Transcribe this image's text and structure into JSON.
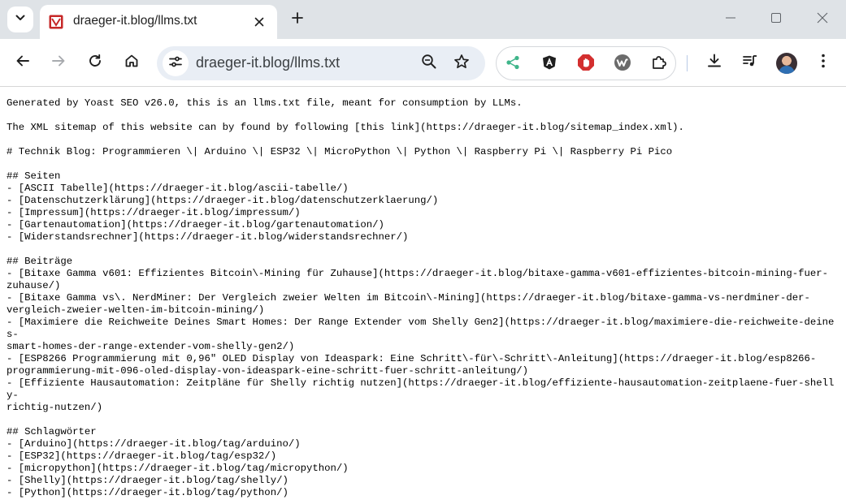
{
  "tab": {
    "title": "draeger-it.blog/llms.txt"
  },
  "toolbar": {
    "url": "draeger-it.blog/llms.txt"
  },
  "extensions": [
    "share-icon",
    "angular-icon",
    "adblock-icon",
    "wappalyzer-icon",
    "puzzle-icon"
  ],
  "document": {
    "lines": [
      "Generated by Yoast SEO v26.0, this is an llms.txt file, meant for consumption by LLMs.",
      "",
      "The XML sitemap of this website can by found by following [this link](https://draeger-it.blog/sitemap_index.xml).",
      "",
      "# Technik Blog: Programmieren \\| Arduino \\| ESP32 \\| MicroPython \\| Python \\| Raspberry Pi \\| Raspberry Pi Pico",
      "",
      "## Seiten",
      "- [ASCII Tabelle](https://draeger-it.blog/ascii-tabelle/)",
      "- [Datenschutzerklärung](https://draeger-it.blog/datenschutzerklaerung/)",
      "- [Impressum](https://draeger-it.blog/impressum/)",
      "- [Gartenautomation](https://draeger-it.blog/gartenautomation/)",
      "- [Widerstandsrechner](https://draeger-it.blog/widerstandsrechner/)",
      "",
      "## Beiträge",
      "- [Bitaxe Gamma v601: Effizientes Bitcoin\\-Mining für Zuhause](https://draeger-it.blog/bitaxe-gamma-v601-effizientes-bitcoin-mining-fuer-",
      "zuhause/)",
      "- [Bitaxe Gamma vs\\. NerdMiner: Der Vergleich zweier Welten im Bitcoin\\-Mining](https://draeger-it.blog/bitaxe-gamma-vs-nerdminer-der-",
      "vergleich-zweier-welten-im-bitcoin-mining/)",
      "- [Maximiere die Reichweite Deines Smart Homes: Der Range Extender vom Shelly Gen2](https://draeger-it.blog/maximiere-die-reichweite-deines-",
      "smart-homes-der-range-extender-vom-shelly-gen2/)",
      "- [ESP8266 Programmierung mit 0,96\" OLED Display von Ideaspark: Eine Schritt\\-für\\-Schritt\\-Anleitung](https://draeger-it.blog/esp8266-",
      "programmierung-mit-096-oled-display-von-ideaspark-eine-schritt-fuer-schritt-anleitung/)",
      "- [Effiziente Hausautomation: Zeitpläne für Shelly richtig nutzen](https://draeger-it.blog/effiziente-hausautomation-zeitplaene-fuer-shelly-",
      "richtig-nutzen/)",
      "",
      "## Schlagwörter",
      "- [Arduino](https://draeger-it.blog/tag/arduino/)",
      "- [ESP32](https://draeger-it.blog/tag/esp32/)",
      "- [micropython](https://draeger-it.blog/tag/micropython/)",
      "- [Shelly](https://draeger-it.blog/tag/shelly/)",
      "- [Python](https://draeger-it.blog/tag/python/)"
    ]
  }
}
